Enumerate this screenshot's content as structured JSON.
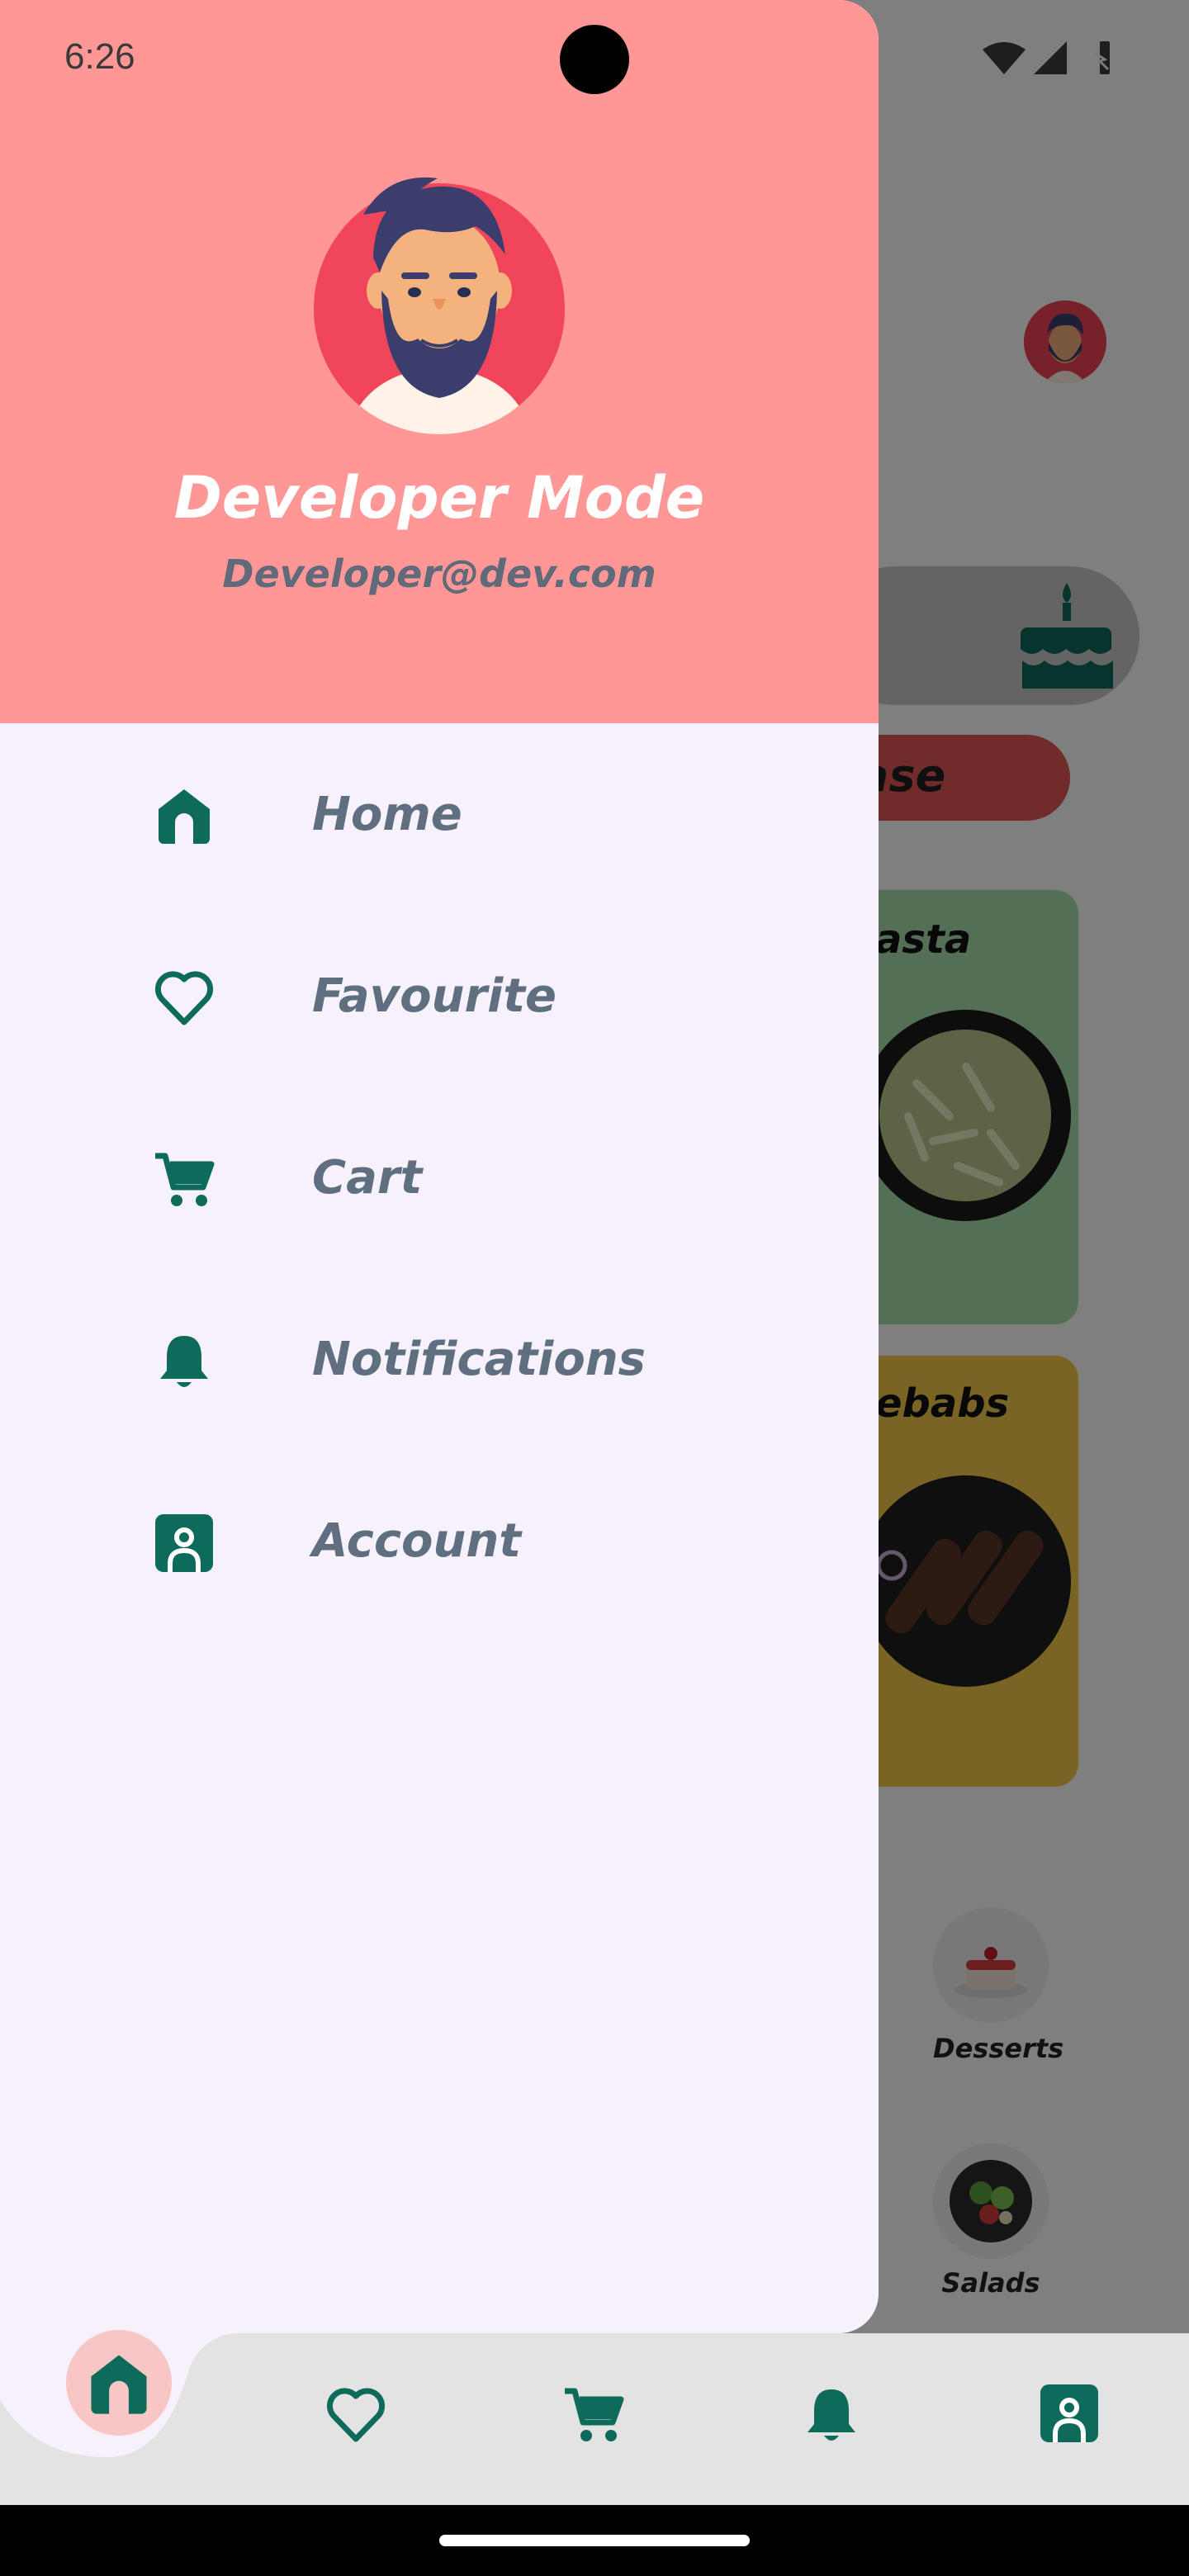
{
  "status_bar": {
    "time": "6:26"
  },
  "profile": {
    "name": "Developer Mode",
    "email": "Developer@dev.com"
  },
  "drawer_menu": [
    {
      "label": "Home",
      "icon": "home-icon"
    },
    {
      "label": "Favourite",
      "icon": "heart-icon"
    },
    {
      "label": "Cart",
      "icon": "cart-icon"
    },
    {
      "label": "Notifications",
      "icon": "bell-icon"
    },
    {
      "label": "Account",
      "icon": "account-icon"
    }
  ],
  "background_app": {
    "banner_partial_text": "ase",
    "cards": [
      {
        "title_partial": "asta"
      },
      {
        "title_partial": "ebabs"
      }
    ],
    "categories": [
      {
        "label": "Desserts"
      },
      {
        "label": "Salads"
      }
    ]
  },
  "bottom_nav": [
    {
      "icon": "home-icon",
      "active": true
    },
    {
      "icon": "heart-icon",
      "active": false
    },
    {
      "icon": "cart-icon",
      "active": false
    },
    {
      "icon": "bell-icon",
      "active": false
    },
    {
      "icon": "account-icon",
      "active": false
    }
  ],
  "colors": {
    "accent": "#0e6b5c",
    "drawer_header": "#ff9797",
    "drawer_bg": "#f6f1fa",
    "menu_text": "#5f6f80",
    "nav_active": "#f9c6c6"
  }
}
